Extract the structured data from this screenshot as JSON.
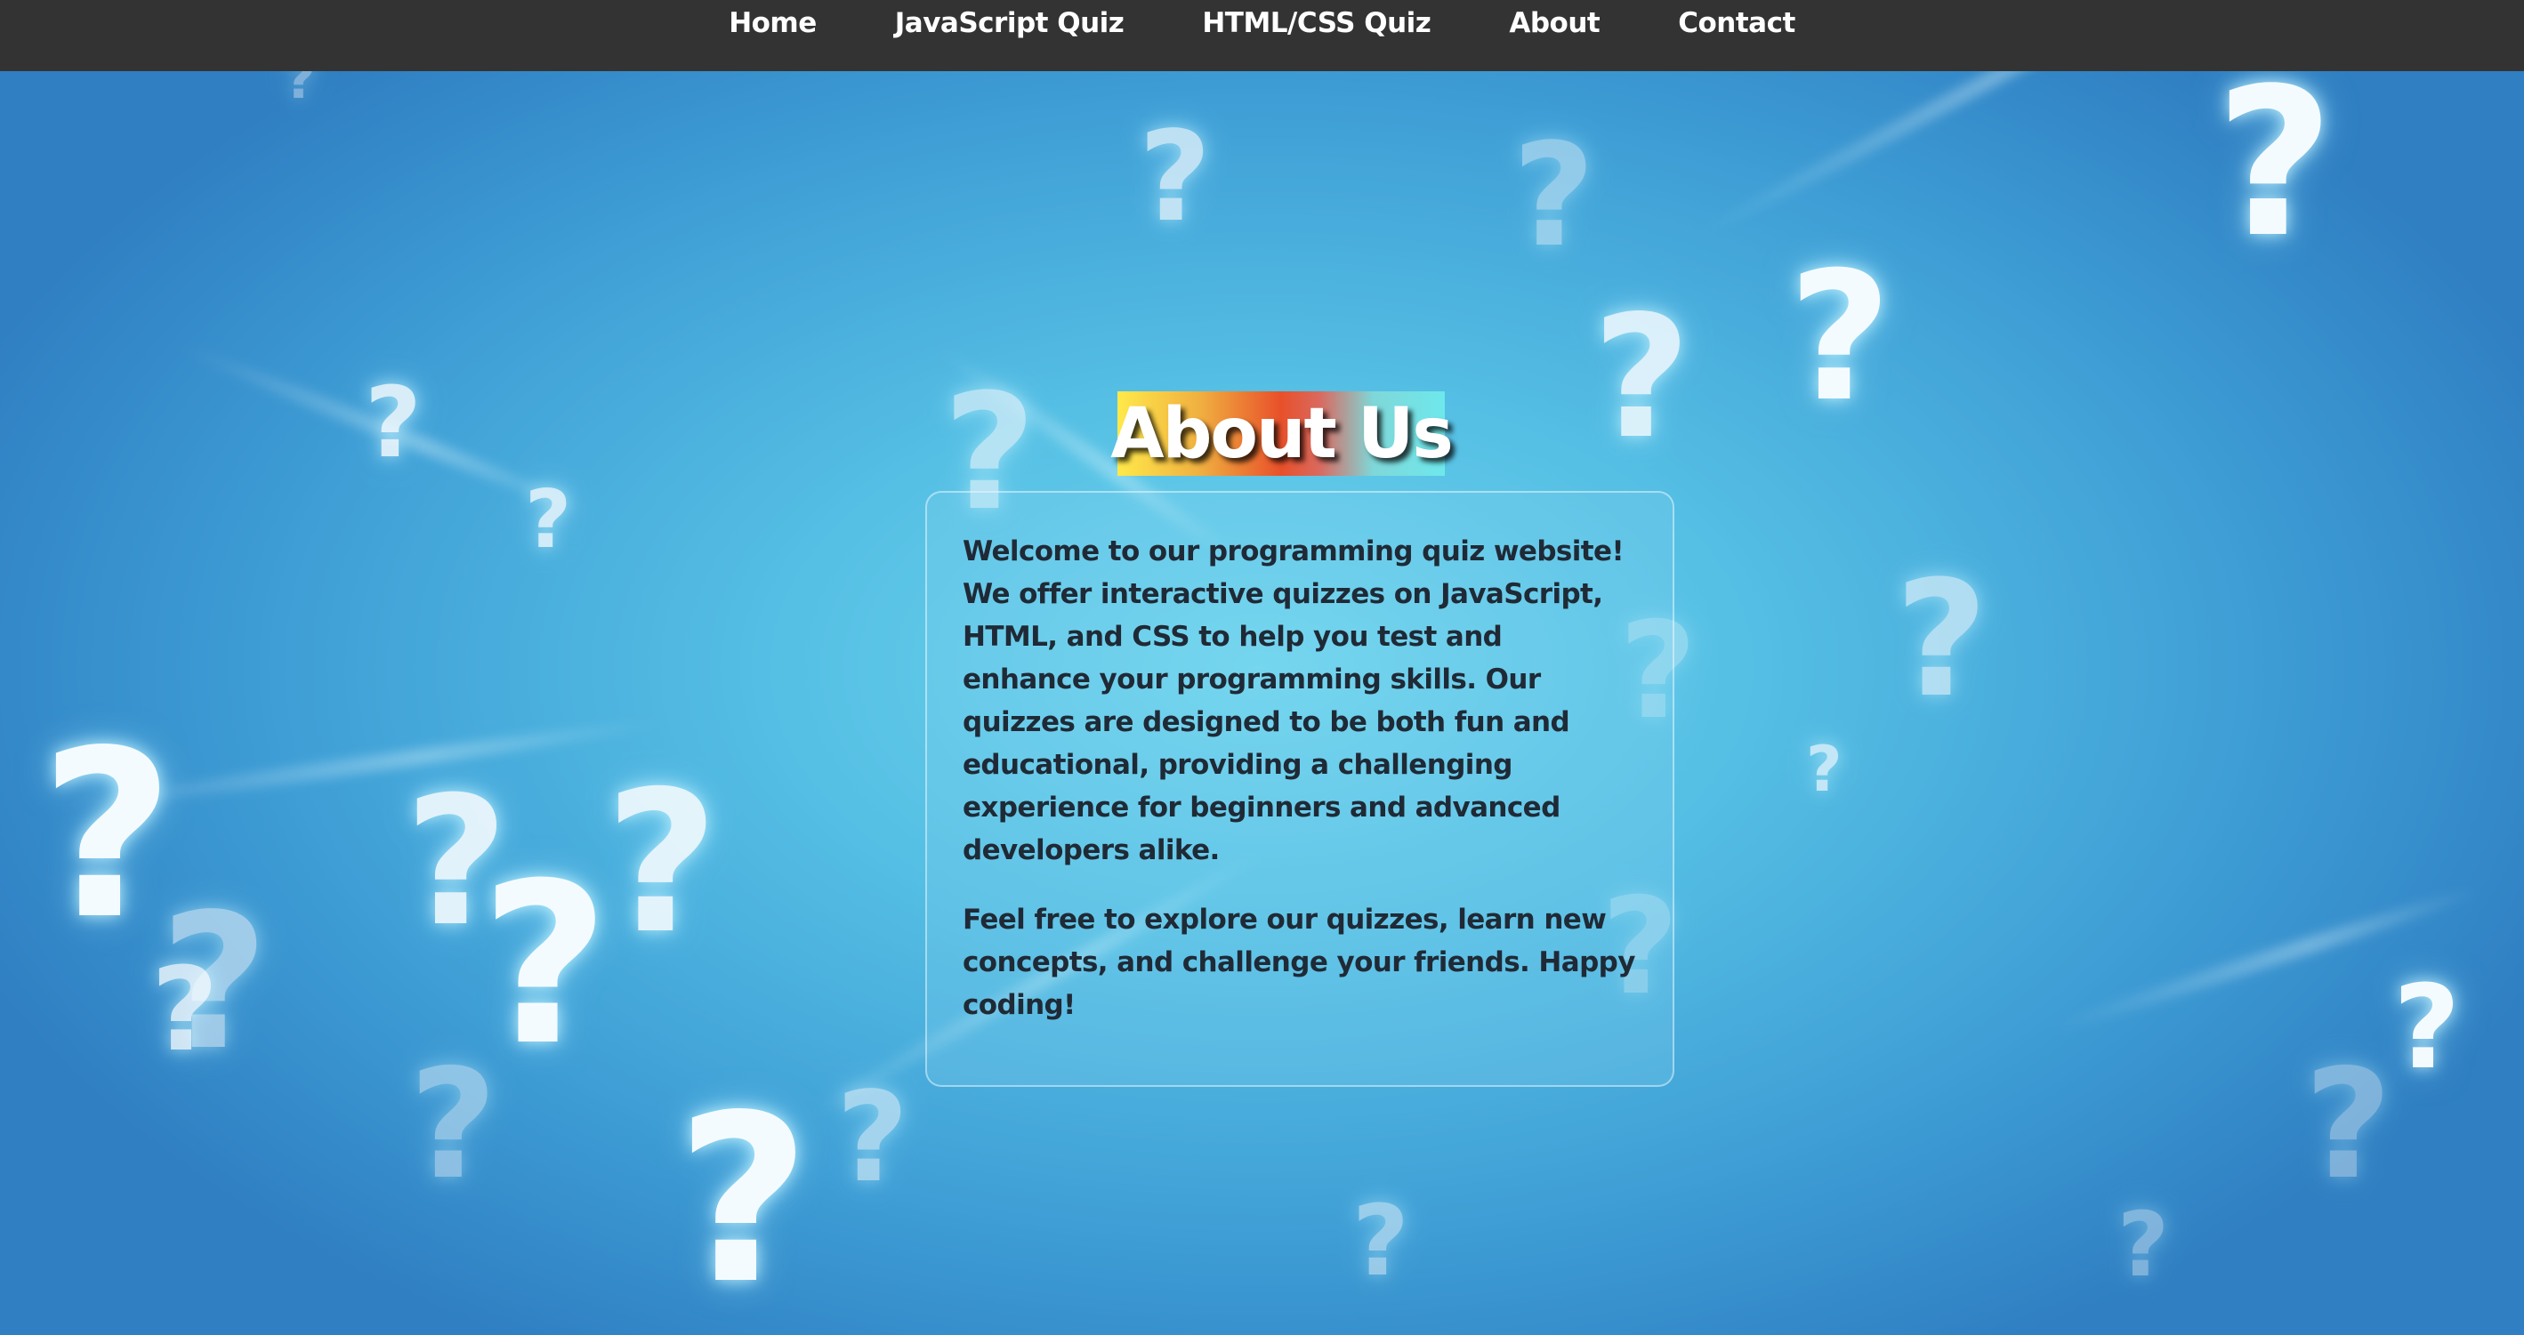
{
  "nav": {
    "items": [
      {
        "label": "Home"
      },
      {
        "label": "JavaScript Quiz"
      },
      {
        "label": "HTML/CSS Quiz"
      },
      {
        "label": "About"
      },
      {
        "label": "Contact"
      }
    ]
  },
  "page": {
    "title": "About Us"
  },
  "about": {
    "paragraph_1": "Welcome to our programming quiz website! We offer interactive quizzes on JavaScript, HTML, and CSS to help you test and enhance your programming skills. Our quizzes are designed to be both fun and educational, providing a challenging experience for beginners and advanced developers alike.",
    "paragraph_2": "Feel free to explore our quizzes, learn new concepts, and challenge your friends. Happy coding!"
  },
  "background": {
    "icon": "question-mark-icon",
    "colors": {
      "center": "#6fd6ee",
      "edge": "#2f7fc2"
    }
  },
  "colors": {
    "navbar": "#333333",
    "nav_text": "#ffffff",
    "body_text": "#1f2a36",
    "title_gradient": [
      "#ffe94a",
      "#e8502a",
      "#6ee8ec"
    ]
  }
}
